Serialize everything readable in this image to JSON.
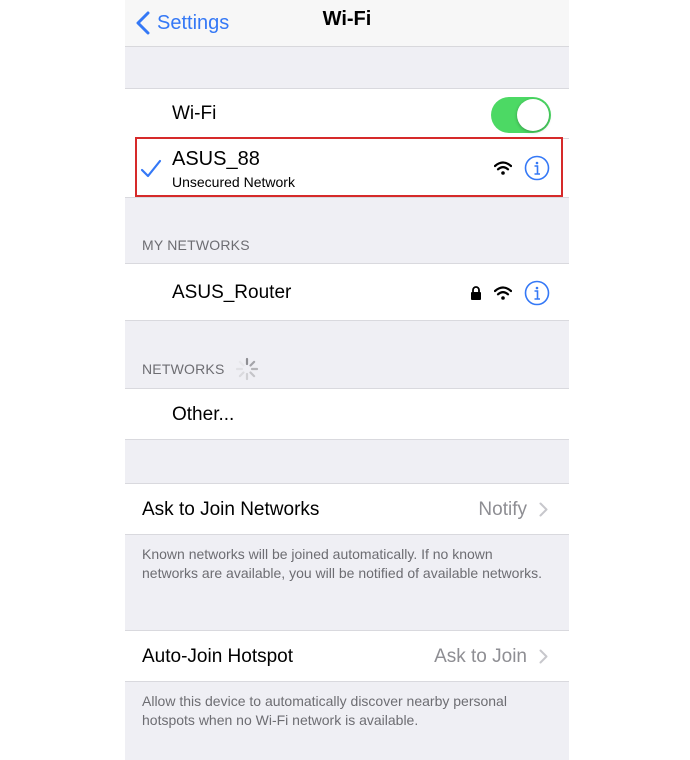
{
  "nav": {
    "back_label": "Settings",
    "title": "Wi-Fi"
  },
  "wifi_row": {
    "label": "Wi-Fi",
    "toggle_on": true
  },
  "connected": {
    "ssid": "ASUS_88",
    "subtitle": "Unsecured Network"
  },
  "my_networks": {
    "header": "MY NETWORKS",
    "items": [
      {
        "ssid": "ASUS_Router",
        "secured": true
      }
    ]
  },
  "networks": {
    "header": "NETWORKS",
    "other_label": "Other..."
  },
  "ask_to_join": {
    "label": "Ask to Join Networks",
    "value": "Notify",
    "footer": "Known networks will be joined automatically. If no known networks are available, you will be notified of available networks."
  },
  "auto_join": {
    "label": "Auto-Join Hotspot",
    "value": "Ask to Join",
    "footer": "Allow this device to automatically discover nearby personal hotspots when no Wi-Fi network is available."
  },
  "colors": {
    "accent": "#3478f6",
    "toggle_on": "#4cd964",
    "highlight": "#d62a2a",
    "group_bg": "#efeff4"
  },
  "icons": [
    "chevron-left-icon",
    "checkmark-icon",
    "wifi-icon",
    "lock-icon",
    "info-icon",
    "spinner-icon",
    "chevron-right-icon"
  ]
}
